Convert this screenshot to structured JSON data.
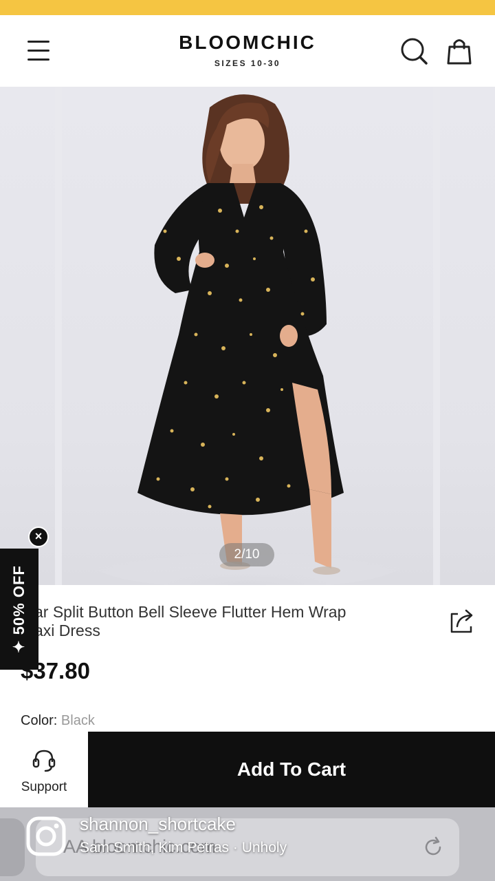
{
  "colors": {
    "top_strip": "#f5c542",
    "cart_button_bg": "#0f0f0f",
    "promo_bg": "#111111",
    "gallery_bg": "#e9e9ee",
    "dress_black": "#141414",
    "star_gold": "#d8b45a"
  },
  "header": {
    "brand_name": "BLOOMCHIC",
    "brand_subtitle": "SIZES 10-30",
    "icons": [
      "menu-icon",
      "search-icon",
      "shopping-bag-icon"
    ]
  },
  "gallery": {
    "counter": "2/10",
    "current_index": 2,
    "total_images": 10
  },
  "promo": {
    "label": "✦ 50% OFF",
    "close_label": "×"
  },
  "product": {
    "title_line1": "ar Split Button Bell Sleeve Flutter Hem Wrap",
    "title_line2": "axi Dress",
    "price": "$37.80",
    "color_label": "Color:",
    "color_value": "Black",
    "share_icon": "share-icon"
  },
  "bottom_bar": {
    "support_label": "Support",
    "support_icon": "headset-icon",
    "add_to_cart_label": "Add To Cart"
  },
  "browser": {
    "url_text": "AA   bloomchic.com",
    "reload_icon": "reload-icon"
  },
  "instagram_overlay": {
    "username": "shannon_shortcake",
    "song": "Sam Smith, Kim Petras · Unholy",
    "icon": "instagram-icon"
  }
}
